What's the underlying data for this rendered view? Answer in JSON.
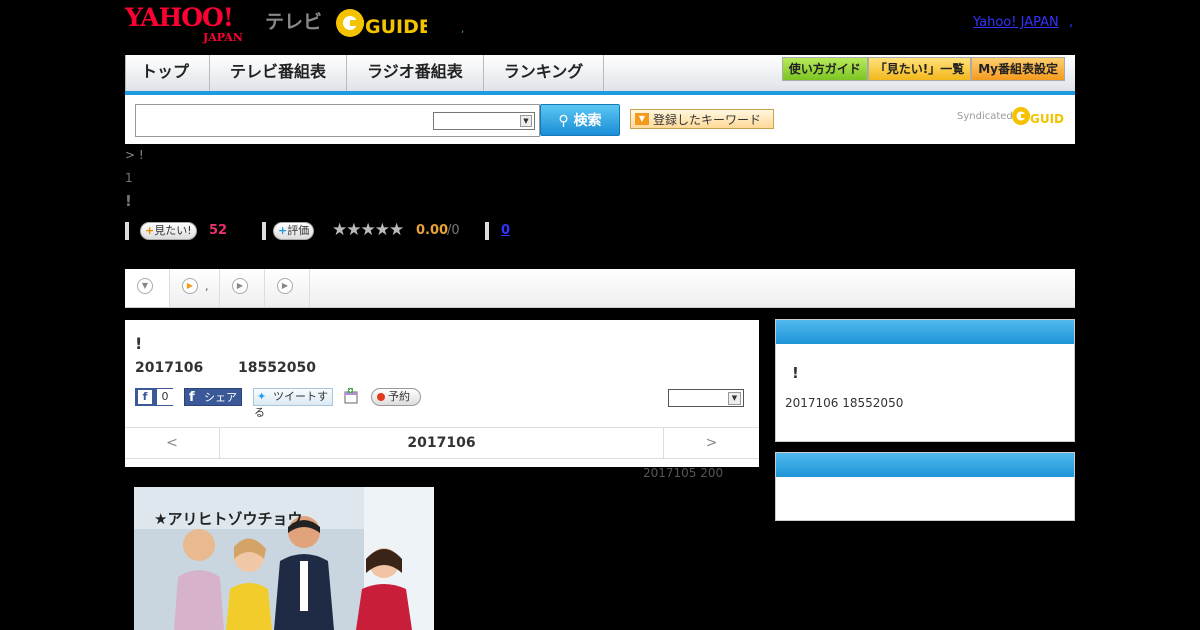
{
  "header": {
    "yahoo_logo": "YAHOO!",
    "yahoo_logo_sub": "JAPAN",
    "tv_label": "テレビ",
    "gguide_logo": "GUIDE",
    "dot": ",",
    "yahoo_japan_link": "Yahoo! JAPAN",
    "comma": ","
  },
  "nav": {
    "tabs": [
      "トップ",
      "テレビ番組表",
      "ラジオ番組表",
      "ランキング"
    ],
    "buttons": [
      "使い方ガイド",
      "「見たい!」一覧",
      "My番組表設定"
    ]
  },
  "search": {
    "placeholder": "",
    "select_value": "",
    "button_label": "検索",
    "keyword_button": "登録したキーワード",
    "syndicated": "Syndicated"
  },
  "breadcrumb": "> !",
  "episode_number": "1",
  "page_title": "!",
  "actions": {
    "want_label": "見たい!",
    "want_count": "52",
    "rate_label": "評価",
    "stars": "★★★★★",
    "rating": "0.00",
    "rating_den": "/0",
    "link_count": "0"
  },
  "subtabs": [
    {
      "label": ""
    },
    {
      "label": ","
    },
    {
      "label": ""
    },
    {
      "label": ""
    }
  ],
  "program": {
    "title": "!",
    "date": "2017106",
    "time": "18552050",
    "fb_like_count": "0",
    "fb_share": "シェア",
    "tweet": "ツイートする",
    "reserve": "予約",
    "select_value": "",
    "pager_prev": "<",
    "pager_center": "2017106",
    "pager_next": ">"
  },
  "note": "2017105  200",
  "photo": {
    "sign": "★アリヒトゾウチョウ"
  },
  "right_panel": {
    "title": "!",
    "subtitle": "2017106  18552050"
  },
  "colors": {
    "accent_blue": "#1e9be0",
    "yahoo_red": "#ff0033",
    "want_pink": "#e8336a",
    "rating_orange": "#e8a23a"
  }
}
